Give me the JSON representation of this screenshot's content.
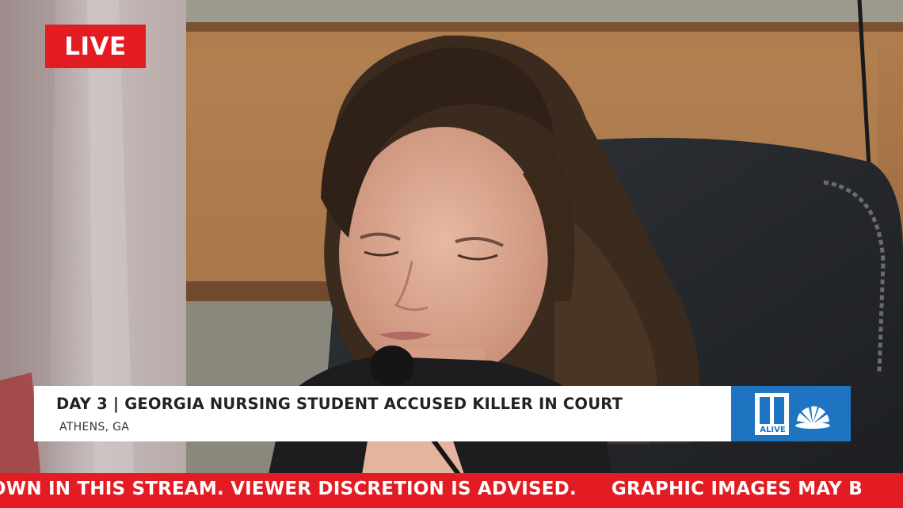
{
  "live_badge": {
    "label": "LIVE"
  },
  "lower_third": {
    "headline": "DAY 3 | GEORGIA NURSING STUDENT ACCUSED KILLER IN COURT",
    "location": "ATHENS, GA"
  },
  "logo": {
    "text": "ALIVE",
    "icon": "11alive-nbc-peacock-logo"
  },
  "ticker": {
    "segments": [
      "OWN IN THIS STREAM. VIEWER DISCRETION IS ADVISED.",
      "GRAPHIC IMAGES MAY B"
    ]
  },
  "colors": {
    "live_red": "#e31c23",
    "ticker_red": "#e31c23",
    "logo_blue": "#1e74c0",
    "lower_third_bg": "#ffffff"
  }
}
